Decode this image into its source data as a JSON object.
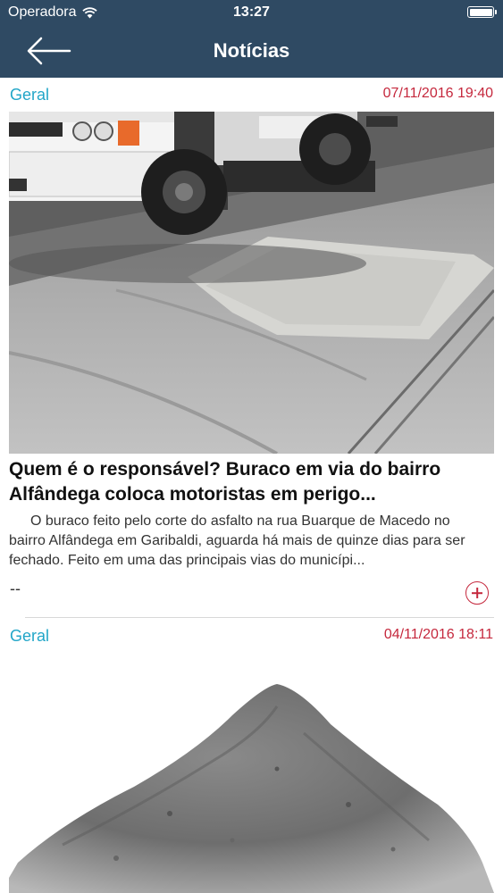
{
  "status_bar": {
    "carrier": "Operadora",
    "time": "13:27"
  },
  "nav": {
    "title": "Notícias"
  },
  "news": [
    {
      "category": "Geral",
      "date": "07/11/2016 19:40",
      "headline": "Quem é o responsável? Buraco em via do bairro Alfândega coloca motoristas em perigo...",
      "summary": "O buraco feito pelo corte do asfalto na rua Buarque de Macedo no bairro Alfândega em Garibaldi, aguarda há mais de quinze dias para ser fechado. Feito em uma das principais vias do municípi...",
      "footer": "--"
    },
    {
      "category": "Geral",
      "date": "04/11/2016 18:11"
    }
  ]
}
